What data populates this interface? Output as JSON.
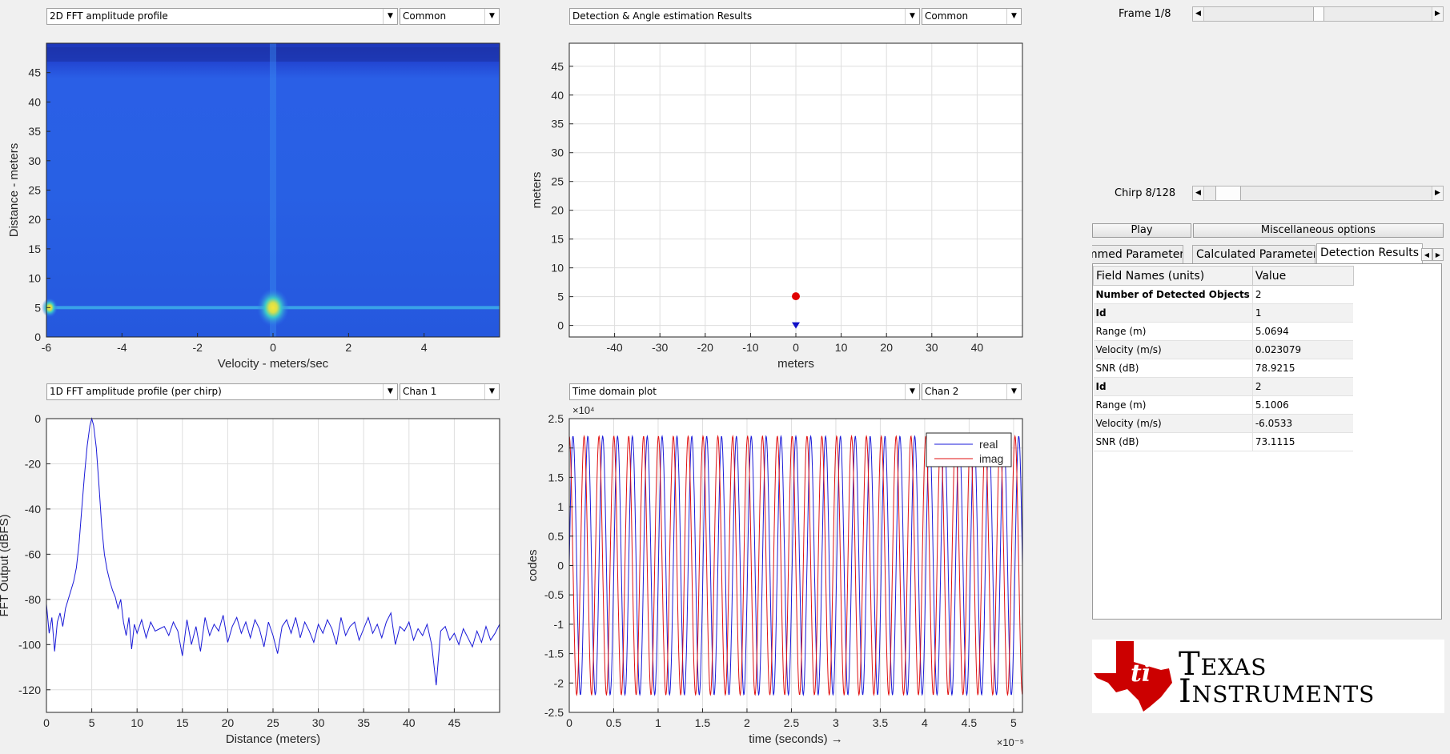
{
  "top_left": {
    "dropdown": "2D FFT amplitude profile",
    "mode": "Common"
  },
  "top_middle": {
    "dropdown": "Detection & Angle estimation Results",
    "mode": "Common"
  },
  "bottom_left": {
    "dropdown": "1D FFT amplitude profile (per chirp)",
    "mode": "Chan 1"
  },
  "bottom_middle": {
    "dropdown": "Time domain plot",
    "mode": "Chan 2"
  },
  "controls": {
    "frame_label": "Frame 1/8",
    "frame_value": 0.5,
    "chirp_label": "Chirp 8/128",
    "chirp_value": 0.06,
    "play_label": "Play",
    "misc_label": "Miscellaneous options"
  },
  "tabs": [
    "mmed Parameters",
    "Calculated Parameters",
    "Detection Results"
  ],
  "active_tab": "Detection Results",
  "results_table": {
    "headers": [
      "Field Names    (units)",
      "Value"
    ],
    "rows": [
      {
        "field": "Number of Detected Objects",
        "value": "2",
        "bold": true
      },
      {
        "field": "Id",
        "value": "1",
        "bold": true
      },
      {
        "field": "Range (m)",
        "value": "5.0694"
      },
      {
        "field": "Velocity (m/s)",
        "value": "0.023079"
      },
      {
        "field": "SNR (dB)",
        "value": "78.9215"
      },
      {
        "field": "Id",
        "value": "2",
        "bold": true
      },
      {
        "field": "Range (m)",
        "value": "5.1006"
      },
      {
        "field": "Velocity (m/s)",
        "value": "-6.0533"
      },
      {
        "field": "SNR (dB)",
        "value": "73.1115"
      }
    ]
  },
  "logo": {
    "line1": "Texas",
    "line2": "Instruments",
    "color": "#cc0000"
  },
  "chart_data": [
    {
      "type": "heatmap",
      "xlabel": "Velocity - meters/sec",
      "ylabel": "Distance - meters",
      "xlim": [
        -6,
        6
      ],
      "ylim": [
        0,
        50
      ],
      "xticks": [
        -6,
        -4,
        -2,
        0,
        2,
        4
      ],
      "yticks": [
        0,
        5,
        10,
        15,
        20,
        25,
        30,
        35,
        40,
        45
      ],
      "peaks": [
        {
          "velocity": 0,
          "distance": 5,
          "level": "max"
        },
        {
          "velocity": -6,
          "distance": 5,
          "level": "high"
        }
      ],
      "colormap": [
        "#1f3fd8",
        "#2a6cf2",
        "#35c9d6",
        "#f2e23a"
      ]
    },
    {
      "type": "scatter",
      "xlabel": "meters",
      "ylabel": "meters",
      "xlim": [
        -50,
        50
      ],
      "ylim": [
        -2,
        49
      ],
      "xticks": [
        -40,
        -30,
        -20,
        -10,
        0,
        10,
        20,
        30,
        40
      ],
      "yticks": [
        0,
        5,
        10,
        15,
        20,
        25,
        30,
        35,
        40,
        45
      ],
      "grid": true,
      "points": [
        {
          "x": 0,
          "y": 5.07,
          "marker": "circle",
          "color": "#e00000"
        },
        {
          "x": 0,
          "y": 0,
          "marker": "triangle-down",
          "color": "#1010c8"
        }
      ]
    },
    {
      "type": "line",
      "xlabel": "Distance (meters)",
      "ylabel": "FFT Output (dBFS)",
      "xlim": [
        0,
        50
      ],
      "ylim": [
        -130,
        0
      ],
      "xticks": [
        0,
        5,
        10,
        15,
        20,
        25,
        30,
        35,
        40,
        45
      ],
      "yticks": [
        0,
        -20,
        -40,
        -60,
        -80,
        -100,
        -120
      ],
      "grid": true,
      "series": [
        {
          "color": "#1a1ad8",
          "x": [
            0,
            0.3,
            0.6,
            0.9,
            1.2,
            1.5,
            1.8,
            2.1,
            2.4,
            2.7,
            3.0,
            3.3,
            3.6,
            3.9,
            4.2,
            4.5,
            4.8,
            5.0,
            5.2,
            5.5,
            5.8,
            6.1,
            6.4,
            6.7,
            7.0,
            7.3,
            7.6,
            7.9,
            8.2,
            8.5,
            8.8,
            9.1,
            9.4,
            9.7,
            10.0,
            10.5,
            11,
            11.5,
            12,
            12.5,
            13,
            13.5,
            14,
            14.5,
            15,
            15.5,
            16,
            16.5,
            17,
            17.5,
            18,
            18.5,
            19,
            19.5,
            20,
            20.5,
            21,
            21.5,
            22,
            22.5,
            23,
            23.5,
            24,
            24.5,
            25,
            25.5,
            26,
            26.5,
            27,
            27.5,
            28,
            28.5,
            29,
            29.5,
            30,
            30.5,
            31,
            31.5,
            32,
            32.5,
            33,
            33.5,
            34,
            34.5,
            35,
            35.5,
            36,
            36.5,
            37,
            37.5,
            38,
            38.5,
            39,
            39.5,
            40,
            40.5,
            41,
            41.5,
            42,
            42.5,
            43,
            43.5,
            44,
            44.5,
            45,
            45.5,
            46,
            46.5,
            47,
            47.5,
            48,
            48.5,
            49,
            49.5,
            50
          ],
          "values": [
            -82,
            -95,
            -88,
            -103,
            -90,
            -86,
            -92,
            -84,
            -80,
            -76,
            -72,
            -66,
            -55,
            -40,
            -25,
            -12,
            -3,
            0,
            -3,
            -13,
            -30,
            -48,
            -60,
            -67,
            -72,
            -76,
            -79,
            -84,
            -80,
            -90,
            -96,
            -88,
            -102,
            -91,
            -95,
            -89,
            -97,
            -90,
            -94,
            -93,
            -92,
            -96,
            -90,
            -94,
            -105,
            -89,
            -100,
            -92,
            -103,
            -88,
            -96,
            -91,
            -94,
            -87,
            -99,
            -92,
            -88,
            -95,
            -90,
            -97,
            -89,
            -93,
            -101,
            -90,
            -96,
            -104,
            -92,
            -89,
            -95,
            -88,
            -97,
            -90,
            -94,
            -99,
            -91,
            -95,
            -89,
            -93,
            -100,
            -88,
            -96,
            -92,
            -90,
            -98,
            -93,
            -88,
            -95,
            -91,
            -97,
            -90,
            -86,
            -100,
            -92,
            -94,
            -90,
            -98,
            -93,
            -96,
            -91,
            -100,
            -118,
            -94,
            -92,
            -98,
            -95,
            -100,
            -93,
            -97,
            -101,
            -94,
            -99,
            -92,
            -98,
            -95,
            -91
          ]
        }
      ]
    },
    {
      "type": "line",
      "xlabel": "time  (seconds) →",
      "ylabel": "codes",
      "xlim": [
        0,
        5.1
      ],
      "ylim": [
        -2.5,
        2.5
      ],
      "x_multiplier": "×10⁻⁵",
      "y_multiplier": "×10⁴",
      "xticks": [
        0,
        0.5,
        1,
        1.5,
        2,
        2.5,
        3,
        3.5,
        4,
        4.5,
        5
      ],
      "yticks": [
        2.5,
        2,
        1.5,
        1,
        0.5,
        0,
        -0.5,
        -1,
        -1.5,
        -2,
        -2.5
      ],
      "grid": true,
      "legend": "top-right",
      "series": [
        {
          "name": "real",
          "color": "#1a1ad8",
          "amplitude": 2.2,
          "cycles": 30.5,
          "phase": 0.0
        },
        {
          "name": "imag",
          "color": "#e01010",
          "amplitude": 2.2,
          "cycles": 30.5,
          "phase": 1.5708
        }
      ]
    }
  ]
}
